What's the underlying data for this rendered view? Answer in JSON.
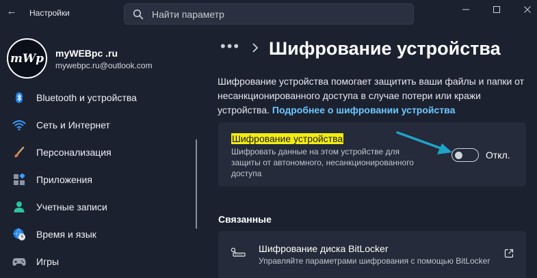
{
  "window": {
    "title": "Настройки",
    "back_glyph": "←",
    "controls": {
      "minimize": "minimize-icon",
      "maximize": "maximize-icon",
      "close": "close-icon"
    }
  },
  "search": {
    "placeholder": "Найти параметр",
    "icon": "search-icon"
  },
  "profile": {
    "avatar_text": "mWp",
    "name": "myWEBpc .ru",
    "email": "mywebpc.ru@outlook.com"
  },
  "sidebar": {
    "items": [
      {
        "label": "Bluetooth и устройства",
        "icon": "bluetooth-icon"
      },
      {
        "label": "Сеть и Интернет",
        "icon": "wifi-icon"
      },
      {
        "label": "Персонализация",
        "icon": "brush-icon"
      },
      {
        "label": "Приложения",
        "icon": "apps-icon"
      },
      {
        "label": "Учетные записи",
        "icon": "person-icon"
      },
      {
        "label": "Время и язык",
        "icon": "globe-clock-icon"
      },
      {
        "label": "Игры",
        "icon": "gamepad-icon"
      }
    ]
  },
  "breadcrumb": {
    "dots": "•••",
    "title": "Шифрование устройства"
  },
  "description": {
    "line1": "Шифрование устройства помогает защитить ваши файлы и папки от",
    "line2": "несанкционированного доступа в случае потери или кражи",
    "line3": "устройства. ",
    "link": "Подробнее о шифровании устройства"
  },
  "encryption_card": {
    "title": "Шифрование устройства",
    "desc_line1": "Шифровать данные на этом устройстве для",
    "desc_line2": "защиты от автономного, несанкционированного",
    "desc_line3": "доступа",
    "toggle_state": "Откл.",
    "toggle_on": false
  },
  "related": {
    "heading": "Связанные",
    "bitlocker": {
      "title": "Шифрование диска BitLocker",
      "desc": "Управляйте параметрами шифрования с помощью BitLocker",
      "icon": "bitlocker-key-icon"
    }
  },
  "colors": {
    "background": "#1c2130",
    "card": "#252b3a",
    "accent_link": "#6cc8ff",
    "highlight": "#f3ec13",
    "arrow": "#1fa3c9"
  }
}
